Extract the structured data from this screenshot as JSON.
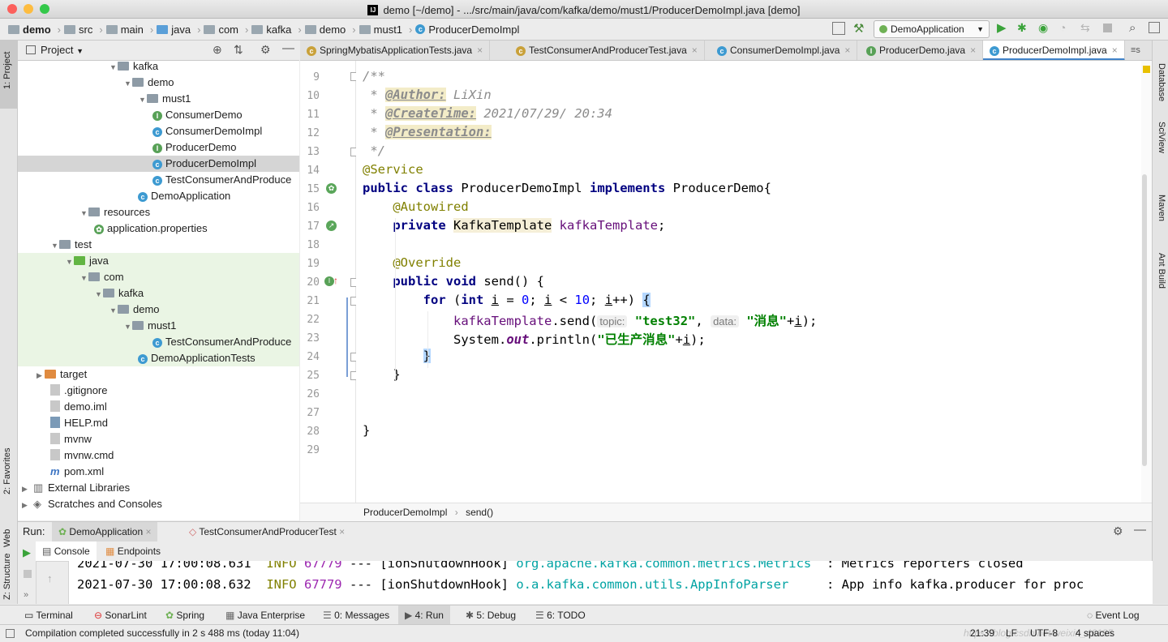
{
  "window": {
    "title": "demo [~/demo] - .../src/main/java/com/kafka/demo/must1/ProducerDemoImpl.java [demo]"
  },
  "navbar": {
    "crumbs": [
      "demo",
      "src",
      "main",
      "java",
      "com",
      "kafka",
      "demo",
      "must1",
      "ProducerDemoImpl"
    ],
    "run_config": "DemoApplication"
  },
  "left_strip": {
    "project": "1: Project",
    "favorites": "2: Favorites",
    "web": "Web",
    "structure": "Z: Structure"
  },
  "right_strip": {
    "database": "Database",
    "sciview": "SciView",
    "maven": "Maven",
    "antbuild": "Ant Build"
  },
  "project_panel": {
    "title": "Project",
    "tree": [
      {
        "label": "kafka",
        "type": "folder"
      },
      {
        "label": "demo",
        "type": "folder"
      },
      {
        "label": "must1",
        "type": "folder"
      },
      {
        "label": "ConsumerDemo",
        "type": "interface"
      },
      {
        "label": "ConsumerDemoImpl",
        "type": "class"
      },
      {
        "label": "ProducerDemo",
        "type": "interface"
      },
      {
        "label": "ProducerDemoImpl",
        "type": "class"
      },
      {
        "label": "TestConsumerAndProduce",
        "type": "class"
      },
      {
        "label": "DemoApplication",
        "type": "spring"
      },
      {
        "label": "resources",
        "type": "folder"
      },
      {
        "label": "application.properties",
        "type": "spring"
      },
      {
        "label": "test",
        "type": "folder"
      },
      {
        "label": "java",
        "type": "folder"
      },
      {
        "label": "com",
        "type": "folder"
      },
      {
        "label": "kafka",
        "type": "folder"
      },
      {
        "label": "demo",
        "type": "folder"
      },
      {
        "label": "must1",
        "type": "folder"
      },
      {
        "label": "TestConsumerAndProduce",
        "type": "class"
      },
      {
        "label": "DemoApplicationTests",
        "type": "class"
      },
      {
        "label": "target",
        "type": "folder"
      },
      {
        "label": ".gitignore",
        "type": "file"
      },
      {
        "label": "demo.iml",
        "type": "file"
      },
      {
        "label": "HELP.md",
        "type": "file"
      },
      {
        "label": "mvnw",
        "type": "file"
      },
      {
        "label": "mvnw.cmd",
        "type": "file"
      },
      {
        "label": "pom.xml",
        "type": "maven"
      },
      {
        "label": "External Libraries",
        "type": "lib"
      },
      {
        "label": "Scratches and Consoles",
        "type": "lib"
      }
    ]
  },
  "editor_tabs": [
    {
      "label": "SpringMybatisApplicationTests.java"
    },
    {
      "label": "TestConsumerAndProducerTest.java"
    },
    {
      "label": "ConsumerDemoImpl.java"
    },
    {
      "label": "ProducerDemo.java"
    },
    {
      "label": "ProducerDemoImpl.java",
      "active": true
    }
  ],
  "editor": {
    "line_numbers": [
      "9",
      "10",
      "11",
      "12",
      "13",
      "14",
      "15",
      "16",
      "17",
      "18",
      "19",
      "20",
      "21",
      "22",
      "23",
      "24",
      "25",
      "26",
      "27",
      "28",
      "29"
    ],
    "author_tag": "@Author:",
    "author": "LiXin",
    "createtime_tag": "@CreateTime:",
    "createtime": "2021/07/29/ 20:34",
    "presentation_tag": "@Presentation:",
    "annotation_service": "@Service",
    "class_decl": {
      "kw1": "public class",
      "name": "ProducerDemoImpl",
      "kw2": "implements",
      "iface": "ProducerDemo{"
    },
    "annotation_autowired": "@Autowired",
    "field_decl": {
      "kw": "private",
      "type": "KafkaTemplate",
      "name": "kafkaTemplate"
    },
    "annotation_override": "@Override",
    "method_decl": {
      "kw": "public void",
      "name": "send() {"
    },
    "for_stmt": {
      "kw": "for",
      "kw2": "int",
      "var": "i",
      "num0": "0",
      "num10": "10"
    },
    "send_call": {
      "obj": "kafkaTemplate",
      "method": ".send(",
      "hint_topic": "topic:",
      "topic": "\"test32\"",
      "hint_data": "data:",
      "data": "\"消息\""
    },
    "println_call": {
      "obj": "System.",
      "field": "out",
      "rest": ".println(",
      "str": "\"已生产消息\""
    },
    "breadcrumb": [
      "ProducerDemoImpl",
      "send()"
    ]
  },
  "run_panel": {
    "label": "Run:",
    "tabs": [
      "DemoApplication",
      "TestConsumerAndProducerTest"
    ],
    "subtabs": [
      "Console",
      "Endpoints"
    ],
    "log_lines": [
      {
        "date": "2021-07-30 17:00:08.631",
        "level": "INFO",
        "pid": "67779",
        "sep": "---",
        "thread": "[ionShutdownHook]",
        "logger": "org.apache.kafka.common.metrics.Metrics",
        "msg": ": Metrics reporters closed"
      },
      {
        "date": "2021-07-30 17:00:08.632",
        "level": "INFO",
        "pid": "67779",
        "sep": "---",
        "thread": "[ionShutdownHook]",
        "logger": "o.a.kafka.common.utils.AppInfoParser",
        "msg": ": App info kafka.producer for proc"
      }
    ]
  },
  "tool_windows": [
    "Terminal",
    "SonarLint",
    "Spring",
    "Java Enterprise",
    "0: Messages",
    "4: Run",
    "5: Debug",
    "6: TODO",
    "Event Log"
  ],
  "status": {
    "message": "Compilation completed successfully in 2 s 488 ms (today 11:04)",
    "position": "21:39",
    "line_sep": "LF",
    "encoding": "UTF-8",
    "indent": "4 spaces",
    "watermark": "https://blog.csdn.net/weixin_46185"
  },
  "colors": {
    "accent": "#4083c9",
    "current_line": "#fffae3",
    "test_bg": "#eaf5e4",
    "selected": "#d5d5d5"
  }
}
